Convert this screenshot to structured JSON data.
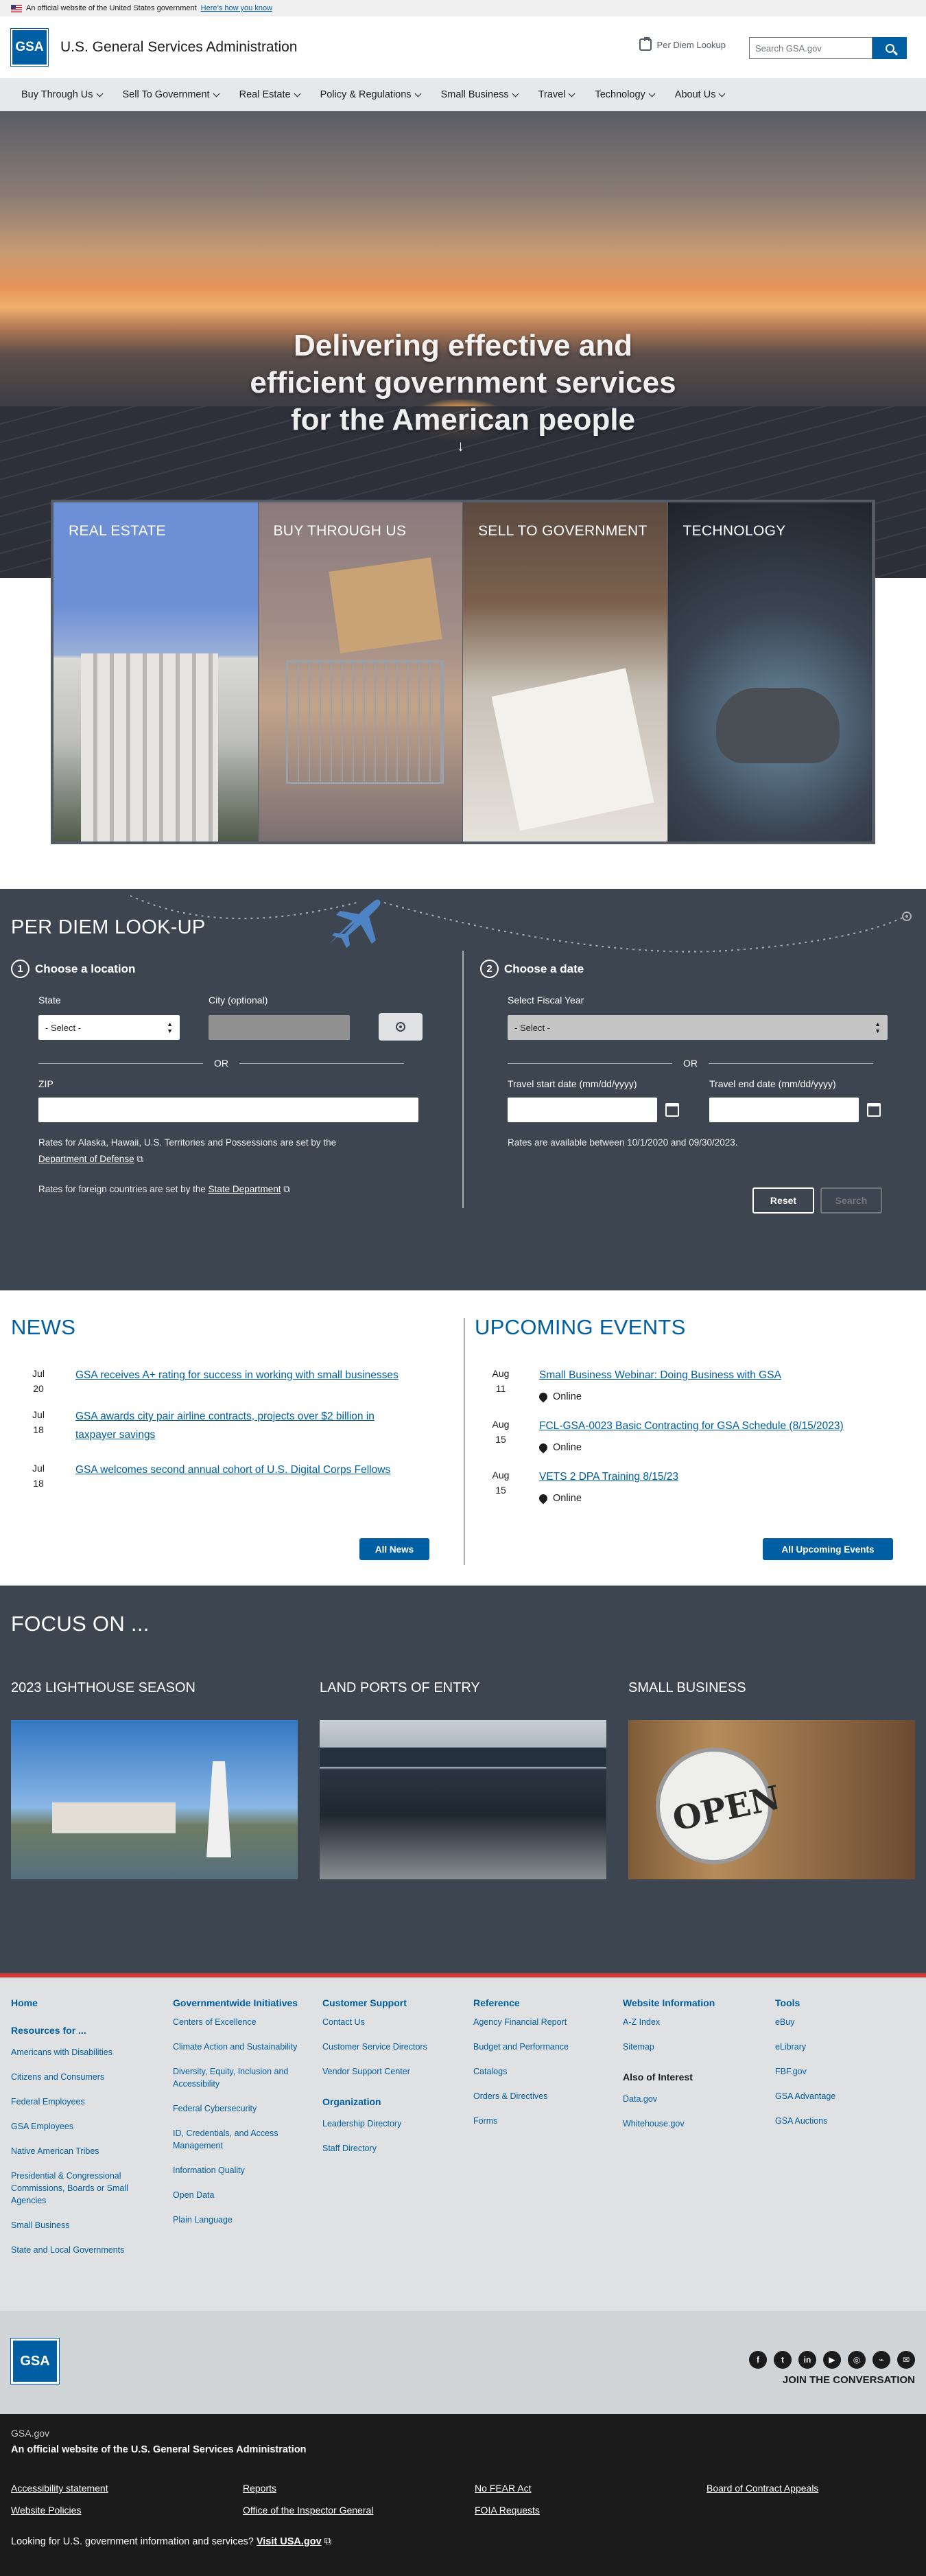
{
  "banner": {
    "text": "An official website of the United States government",
    "link": "Here’s how you know"
  },
  "header": {
    "logo": "GSA",
    "agency": "U.S. General Services Administration",
    "per_diem": "Per Diem Lookup",
    "search_placeholder": "Search GSA.gov"
  },
  "nav": [
    "Buy Through Us",
    "Sell To Government",
    "Real Estate",
    "Policy & Regulations",
    "Small Business",
    "Travel",
    "Technology",
    "About Us"
  ],
  "hero": {
    "line1": "Delivering effective and",
    "line2": "efficient government services",
    "line3": "for the American people"
  },
  "cards": [
    "REAL ESTATE",
    "BUY THROUGH US",
    "SELL TO GOVERNMENT",
    "TECHNOLOGY"
  ],
  "perdiem": {
    "title": "PER DIEM LOOK-UP",
    "step1_num": "1",
    "step1": "Choose a location",
    "step2_num": "2",
    "step2": "Choose a date",
    "state_label": "State",
    "state_value": "- Select -",
    "city_label": "City (optional)",
    "or": "OR",
    "zip_label": "ZIP",
    "note1": "Rates for Alaska, Hawaii, U.S. Territories and Possessions are set by the",
    "note1_link": "Department of Defense",
    "note2": "Rates for foreign countries are set by the",
    "note2_link": "State Department",
    "fy_label": "Select Fiscal Year",
    "fy_value": "- Select -",
    "start_label": "Travel start date (mm/dd/yyyy)",
    "end_label": "Travel end date (mm/dd/yyyy)",
    "avail": "Rates are available between 10/1/2020 and 09/30/2023.",
    "reset": "Reset",
    "search": "Search"
  },
  "news": {
    "title": "NEWS",
    "items": [
      {
        "m": "Jul",
        "d": "20",
        "text": "GSA receives A+ rating for success in working with small businesses"
      },
      {
        "m": "Jul",
        "d": "18",
        "text1": "GSA awards city pair airline contracts, projects over $2 billion in",
        "text2": "taxpayer savings"
      },
      {
        "m": "Jul",
        "d": "18",
        "text": "GSA welcomes second annual cohort of U.S. Digital Corps Fellows"
      }
    ],
    "button": "All News"
  },
  "events": {
    "title": "UPCOMING EVENTS",
    "items": [
      {
        "m": "Aug",
        "d": "11",
        "text": "Small Business Webinar: Doing Business with GSA",
        "loc": "Online"
      },
      {
        "m": "Aug",
        "d": "15",
        "text": "FCL-GSA-0023 Basic Contracting for GSA Schedule (8/15/2023)",
        "loc": "Online"
      },
      {
        "m": "Aug",
        "d": "15",
        "text": "VETS 2 DPA Training 8/15/23",
        "loc": "Online"
      }
    ],
    "button": "All Upcoming Events"
  },
  "focus": {
    "title": "FOCUS ON ...",
    "items": [
      "2023 LIGHTHOUSE SEASON",
      "LAND PORTS OF ENTRY",
      "SMALL BUSINESS"
    ],
    "open_sign": "OPEN"
  },
  "footer": {
    "col1": {
      "h": "Home",
      "sub": "Resources for ...",
      "links": [
        "Americans with Disabilities",
        "Citizens and Consumers",
        "Federal Employees",
        "GSA Employees",
        "Native American Tribes",
        "Presidential & Congressional Commissions, Boards or Small Agencies",
        "Small Business",
        "State and Local Governments"
      ]
    },
    "col2": {
      "h": "Governmentwide Initiatives",
      "links": [
        "Centers of Excellence",
        "Climate Action and Sustainability",
        "Diversity, Equity, Inclusion and Accessibility",
        "Federal Cybersecurity",
        "ID, Credentials, and Access Management",
        "Information Quality",
        "Open Data",
        "Plain Language"
      ]
    },
    "col3": {
      "h": "Customer Support",
      "links": [
        "Contact Us",
        "Customer Service Directors",
        "Vendor Support Center"
      ],
      "sub": "Organization",
      "links2": [
        "Leadership Directory",
        "Staff Directory"
      ]
    },
    "col4": {
      "h": "Reference",
      "links": [
        "Agency Financial Report",
        "Budget and Performance",
        "Catalogs",
        "Orders & Directives",
        "Forms"
      ]
    },
    "col5": {
      "h": "Website Information",
      "links": [
        "A-Z Index",
        "Sitemap"
      ],
      "sub": "Also of Interest",
      "links2": [
        "Data.gov",
        "Whitehouse.gov"
      ]
    },
    "col6": {
      "h": "Tools",
      "links": [
        "eBuy",
        "eLibrary",
        "FBF.gov",
        "GSA Advantage",
        "GSA Auctions"
      ]
    }
  },
  "social": {
    "logo": "GSA",
    "join": "JOIN THE CONVERSATION",
    "icons": [
      "facebook-icon",
      "twitter-icon",
      "linkedin-icon",
      "youtube-icon",
      "instagram-icon",
      "rss-icon",
      "email-icon"
    ]
  },
  "identifier": {
    "domain": "GSA.gov",
    "official": "An official website of the U.S. General Services Administration",
    "links": [
      "Accessibility statement",
      "Reports",
      "No FEAR Act",
      "Board of Contract Appeals",
      "Website Policies",
      "Office of the Inspector General",
      "FOIA Requests"
    ],
    "usa_text": "Looking for U.S. government information and services?",
    "usa_link": "Visit USA.gov"
  }
}
